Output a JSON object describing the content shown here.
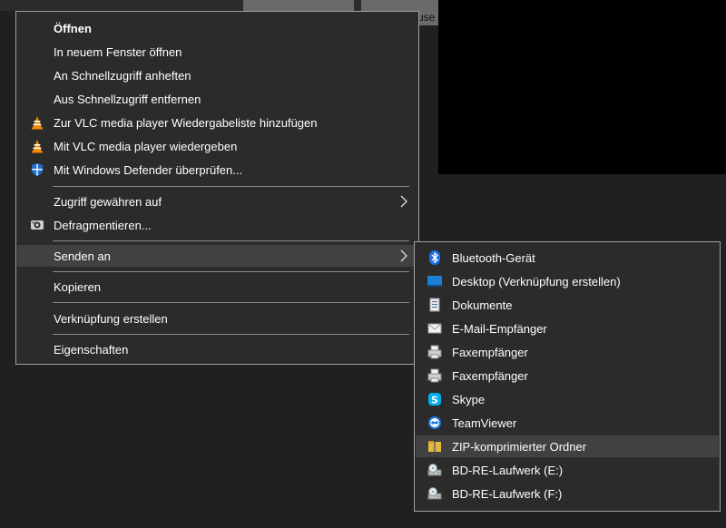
{
  "background": {
    "thumb_label": "use"
  },
  "context_menu": {
    "items": [
      {
        "label": "Öffnen",
        "icon": "none"
      },
      {
        "label": "In neuem Fenster öffnen",
        "icon": "none"
      },
      {
        "label": "An Schnellzugriff anheften",
        "icon": "none"
      },
      {
        "label": "Aus Schnellzugriff entfernen",
        "icon": "none"
      },
      {
        "label": "Zur VLC media player Wiedergabeliste hinzufügen",
        "icon": "vlc-cone-icon"
      },
      {
        "label": "Mit VLC media player wiedergeben",
        "icon": "vlc-cone-icon"
      },
      {
        "label": "Mit Windows Defender überprüfen...",
        "icon": "windows-defender-shield-icon"
      },
      {
        "label": "Zugriff gewähren auf",
        "icon": "none",
        "submenu": true
      },
      {
        "label": "Defragmentieren...",
        "icon": "defragment-icon"
      },
      {
        "label": "Senden an",
        "icon": "none",
        "submenu": true,
        "highlighted": true
      },
      {
        "label": "Kopieren",
        "icon": "none"
      },
      {
        "label": "Verknüpfung erstellen",
        "icon": "none"
      },
      {
        "label": "Eigenschaften",
        "icon": "none"
      }
    ]
  },
  "send_to_menu": {
    "items": [
      {
        "label": "Bluetooth-Gerät",
        "icon": "bluetooth-icon"
      },
      {
        "label": "Desktop (Verknüpfung erstellen)",
        "icon": "desktop-icon"
      },
      {
        "label": "Dokumente",
        "icon": "documents-icon"
      },
      {
        "label": "E-Mail-Empfänger",
        "icon": "mail-icon"
      },
      {
        "label": "Faxempfänger",
        "icon": "fax-icon"
      },
      {
        "label": "Faxempfänger",
        "icon": "fax-icon"
      },
      {
        "label": "Skype",
        "icon": "skype-icon"
      },
      {
        "label": "TeamViewer",
        "icon": "teamviewer-icon"
      },
      {
        "label": "ZIP-komprimierter Ordner",
        "icon": "zip-folder-icon",
        "highlighted": true
      },
      {
        "label": "BD-RE-Laufwerk (E:)",
        "icon": "disc-drive-icon"
      },
      {
        "label": "BD-RE-Laufwerk (F:)",
        "icon": "disc-drive-icon"
      }
    ]
  },
  "colors": {
    "menu_bg": "#2b2b2b",
    "highlight": "#414141",
    "border": "#a0a0a0",
    "vlc_orange": "#f08a00",
    "defender_blue": "#1e6fd0",
    "bluetooth_blue": "#1f6fe5",
    "skype_blue": "#00aff0"
  }
}
